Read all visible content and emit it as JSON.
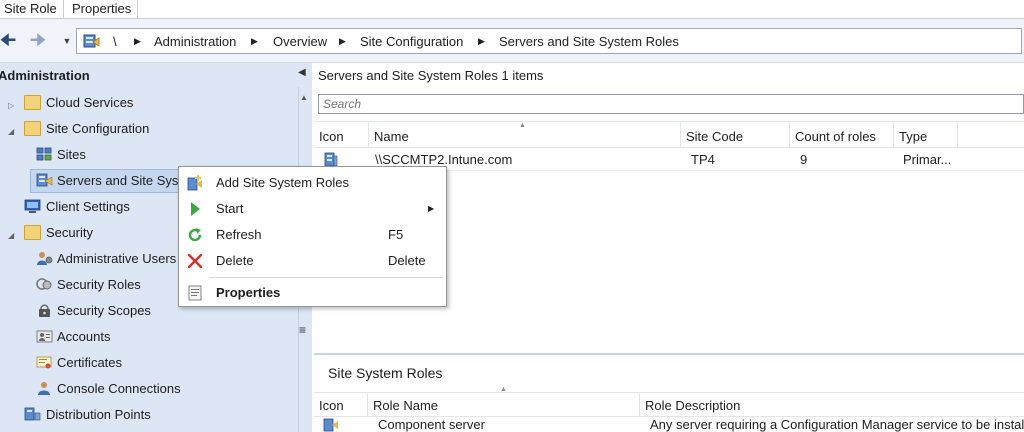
{
  "ribbon": {
    "tabs": [
      "Site Role",
      "Properties"
    ]
  },
  "breadcrumb": {
    "root": "\\",
    "items": [
      "Administration",
      "Overview",
      "Site Configuration",
      "Servers and Site System Roles"
    ]
  },
  "nav": {
    "title": "Administration",
    "items": [
      {
        "label": "Cloud Services",
        "icon": "folder-icon"
      },
      {
        "label": "Site Configuration",
        "icon": "folder-icon"
      },
      {
        "label": "Sites",
        "icon": "sites-icon"
      },
      {
        "label": "Servers and Site Syste",
        "icon": "server-roles-icon"
      },
      {
        "label": "Client Settings",
        "icon": "client-settings-icon"
      },
      {
        "label": "Security",
        "icon": "folder-icon"
      },
      {
        "label": "Administrative Users",
        "icon": "admin-users-icon"
      },
      {
        "label": "Security Roles",
        "icon": "security-roles-icon"
      },
      {
        "label": "Security Scopes",
        "icon": "security-scopes-icon"
      },
      {
        "label": "Accounts",
        "icon": "accounts-icon"
      },
      {
        "label": "Certificates",
        "icon": "certificates-icon"
      },
      {
        "label": "Console Connections",
        "icon": "console-connections-icon"
      },
      {
        "label": "Distribution Points",
        "icon": "distribution-points-icon"
      }
    ]
  },
  "results": {
    "title": "Servers and Site System Roles",
    "count": "1 items",
    "search_placeholder": "Search",
    "columns": [
      "Icon",
      "Name",
      "Site Code",
      "Count of roles",
      "Type"
    ],
    "rows": [
      {
        "name": "\\\\SCCMTP2.Intune.com",
        "site_code": "TP4",
        "count_of_roles": "9",
        "type": "Primar..."
      }
    ]
  },
  "details": {
    "title": "Site System Roles",
    "columns": [
      "Icon",
      "Role Name",
      "Role Description"
    ],
    "rows": [
      {
        "role_name": "Component server",
        "role_description": "Any server requiring a Configuration Manager service to be install"
      }
    ]
  },
  "context_menu": {
    "items": [
      {
        "label": "Add Site System Roles",
        "shortcut": ""
      },
      {
        "label": "Start",
        "shortcut": ""
      },
      {
        "label": "Refresh",
        "shortcut": "F5"
      },
      {
        "label": "Delete",
        "shortcut": "Delete"
      },
      {
        "label": "Properties",
        "shortcut": ""
      }
    ]
  },
  "colors": {
    "nav_bg": "#dce6f4",
    "selection": "#c4d7ef",
    "accent": "#2a4a7a"
  }
}
